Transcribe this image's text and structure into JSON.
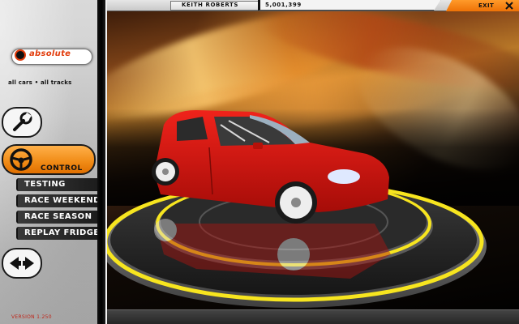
{
  "header": {
    "player_name": "KEITH ROBERTS",
    "credits": "5,001,399",
    "exit_label": "EXIT"
  },
  "brand": {
    "logo_text": "absolute",
    "tagline": "all cars • all tracks"
  },
  "sidebar": {
    "control_label": "CONTROL",
    "menu": [
      {
        "label": "TESTING"
      },
      {
        "label": "RACE WEEKEND"
      },
      {
        "label": "RACE SEASON"
      },
      {
        "label": "REPLAY FRIDGE"
      }
    ],
    "version": "VERSION 1.250"
  },
  "icons": {
    "setup": "wrench-icon",
    "control": "steering-wheel-icon",
    "back": "back-arrows-icon",
    "exit": "close-x-icon"
  },
  "colors": {
    "accent_orange": "#f08a15",
    "car_red": "#d8110e",
    "platform_yellow": "#f7e51f",
    "menu_dark": "#1c1c1c",
    "logo_red": "#e23b0b"
  }
}
